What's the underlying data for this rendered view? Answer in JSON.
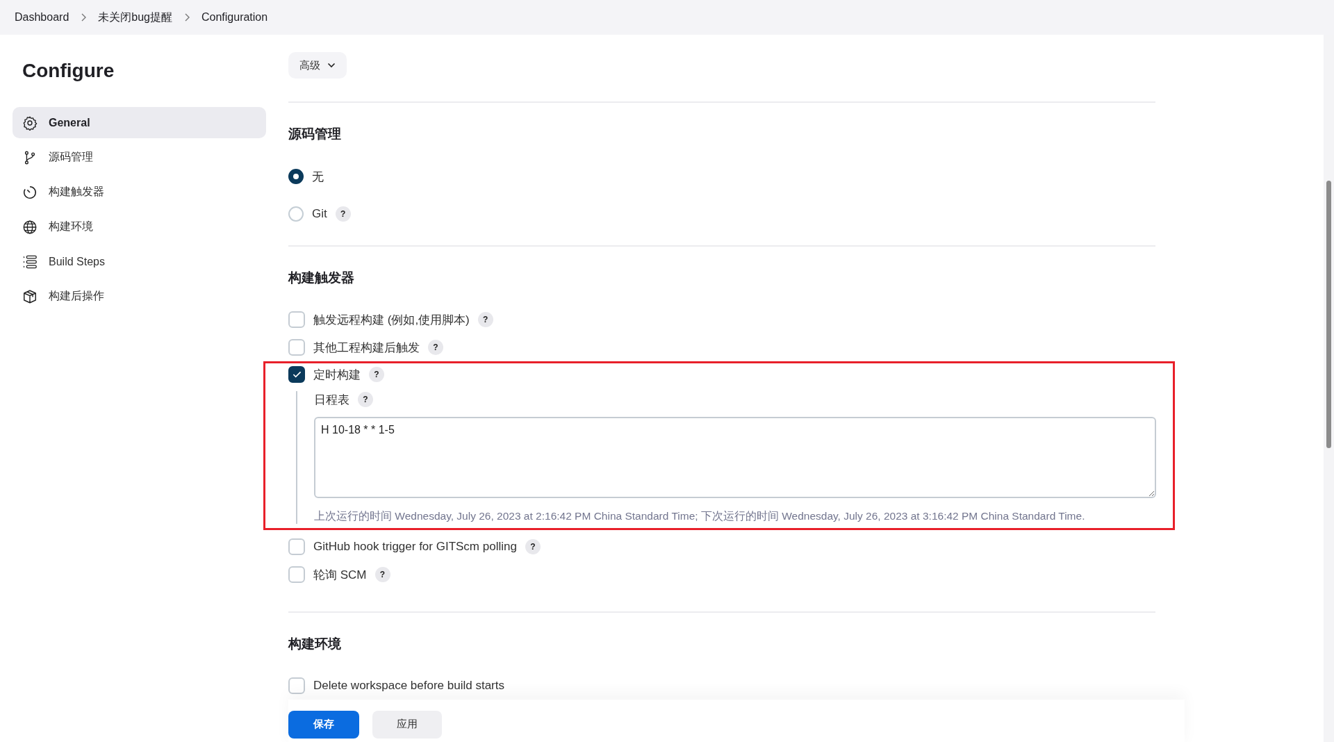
{
  "breadcrumbs": [
    "Dashboard",
    "未关闭bug提醒",
    "Configuration"
  ],
  "sidebar": {
    "title": "Configure",
    "items": [
      {
        "label": "General",
        "selected": true
      },
      {
        "label": "源码管理",
        "selected": false
      },
      {
        "label": "构建触发器",
        "selected": false
      },
      {
        "label": "构建环境",
        "selected": false
      },
      {
        "label": "Build Steps",
        "selected": false
      },
      {
        "label": "构建后操作",
        "selected": false
      }
    ]
  },
  "advanced_button": {
    "label": "高级"
  },
  "sections": [
    {
      "title": "源码管理",
      "options": [
        {
          "kind": "radio",
          "label": "无",
          "selected": true
        },
        {
          "kind": "radio",
          "label": "Git",
          "selected": false,
          "help": "?"
        }
      ]
    },
    {
      "title": "构建触发器",
      "options": [
        {
          "kind": "checkbox",
          "label": "触发远程构建 (例如,使用脚本)",
          "checked": false,
          "help": "?"
        },
        {
          "kind": "checkbox",
          "label": "其他工程构建后触发",
          "checked": false,
          "help": "?"
        },
        {
          "kind": "checkbox",
          "label": "定时构建",
          "checked": true,
          "help": "?",
          "highlighted": true,
          "schedule": {
            "label": "日程表",
            "help": "?",
            "value": "H 10-18 * * 1-5",
            "note": "上次运行的时间 Wednesday, July 26, 2023 at 2:16:42 PM China Standard Time; 下次运行的时间 Wednesday, July 26, 2023 at 3:16:42 PM China Standard Time."
          }
        },
        {
          "kind": "checkbox",
          "label": "GitHub hook trigger for GITScm polling",
          "checked": false,
          "help": "?"
        },
        {
          "kind": "checkbox",
          "label": "轮询 SCM",
          "checked": false,
          "help": "?"
        }
      ]
    },
    {
      "title": "构建环境",
      "options": [
        {
          "kind": "checkbox",
          "label": "Delete workspace before build starts",
          "checked": false
        }
      ]
    }
  ],
  "buttons": [
    {
      "label": "保存",
      "kind": "primary"
    },
    {
      "label": "应用",
      "kind": "secondary"
    }
  ]
}
